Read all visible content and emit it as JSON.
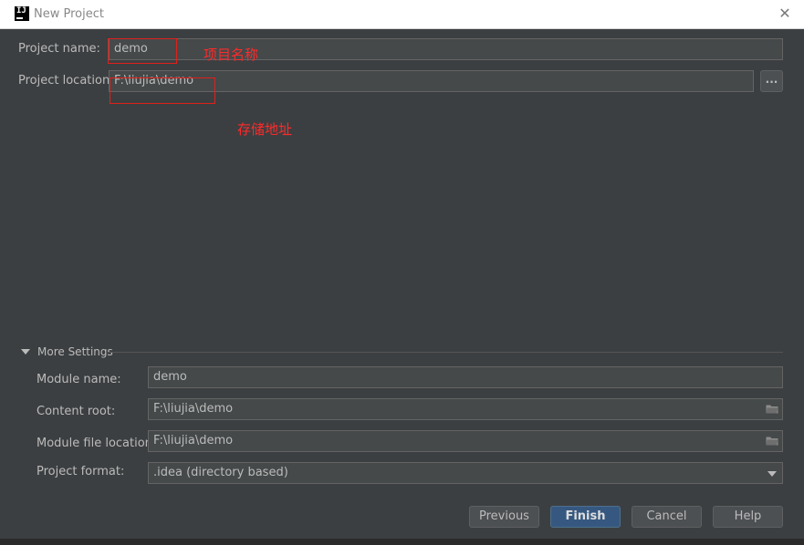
{
  "window": {
    "title": "New Project",
    "close_glyph": "✕",
    "logo_text": "IJ"
  },
  "project": {
    "name_label": "Project name:",
    "name_value": "demo",
    "location_label": "Project location:",
    "location_value": "F:\\liujia\\demo",
    "browse_label": "..."
  },
  "annotations": {
    "name_note": "项目名称",
    "location_note": "存储地址",
    "color": "#ff2a2a"
  },
  "more_settings": {
    "header": "More Settings",
    "module_name_label": "Module name:",
    "module_name_value": "demo",
    "content_root_label": "Content root:",
    "content_root_value": "F:\\liujia\\demo",
    "module_file_label": "Module file location:",
    "module_file_value": "F:\\liujia\\demo",
    "format_label": "Project format:",
    "format_value": ".idea (directory based)"
  },
  "buttons": {
    "previous": "Previous",
    "finish": "Finish",
    "cancel": "Cancel",
    "help": "Help"
  },
  "icons": {
    "folder": "folder-icon",
    "close": "close-icon",
    "expand": "triangle-down-icon",
    "dropdown": "chevron-down-icon"
  },
  "theme": {
    "background": "#3c3f41",
    "field": "#45494a",
    "primary_button": "#365880"
  }
}
